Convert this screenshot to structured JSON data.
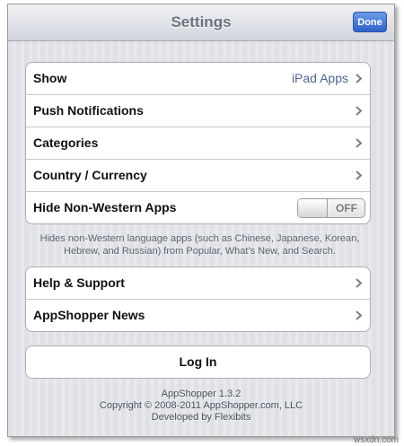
{
  "navbar": {
    "title": "Settings",
    "done_label": "Done"
  },
  "settings_group": {
    "show": {
      "label": "Show",
      "value": "iPad Apps"
    },
    "push": {
      "label": "Push Notifications"
    },
    "categories": {
      "label": "Categories"
    },
    "country": {
      "label": "Country / Currency"
    },
    "hide_non_western": {
      "label": "Hide Non-Western Apps",
      "state": "OFF"
    }
  },
  "footnote": "Hides non-Western language apps (such as Chinese, Japanese, Korean, Hebrew, and Russian) from Popular, What's New, and Search.",
  "support_group": {
    "help": {
      "label": "Help & Support"
    },
    "news": {
      "label": "AppShopper News"
    }
  },
  "login_label": "Log In",
  "credits": {
    "version": "AppShopper 1.3.2",
    "copyright": "Copyright © 2008-2011 AppShopper.com, LLC",
    "developer": "Developed by Flexibits"
  },
  "watermark": "wsxdn.com",
  "icons": {
    "chevron": "chevron-right-icon"
  },
  "colors": {
    "accent": "#2e61c9",
    "value_text": "#4d6690"
  }
}
